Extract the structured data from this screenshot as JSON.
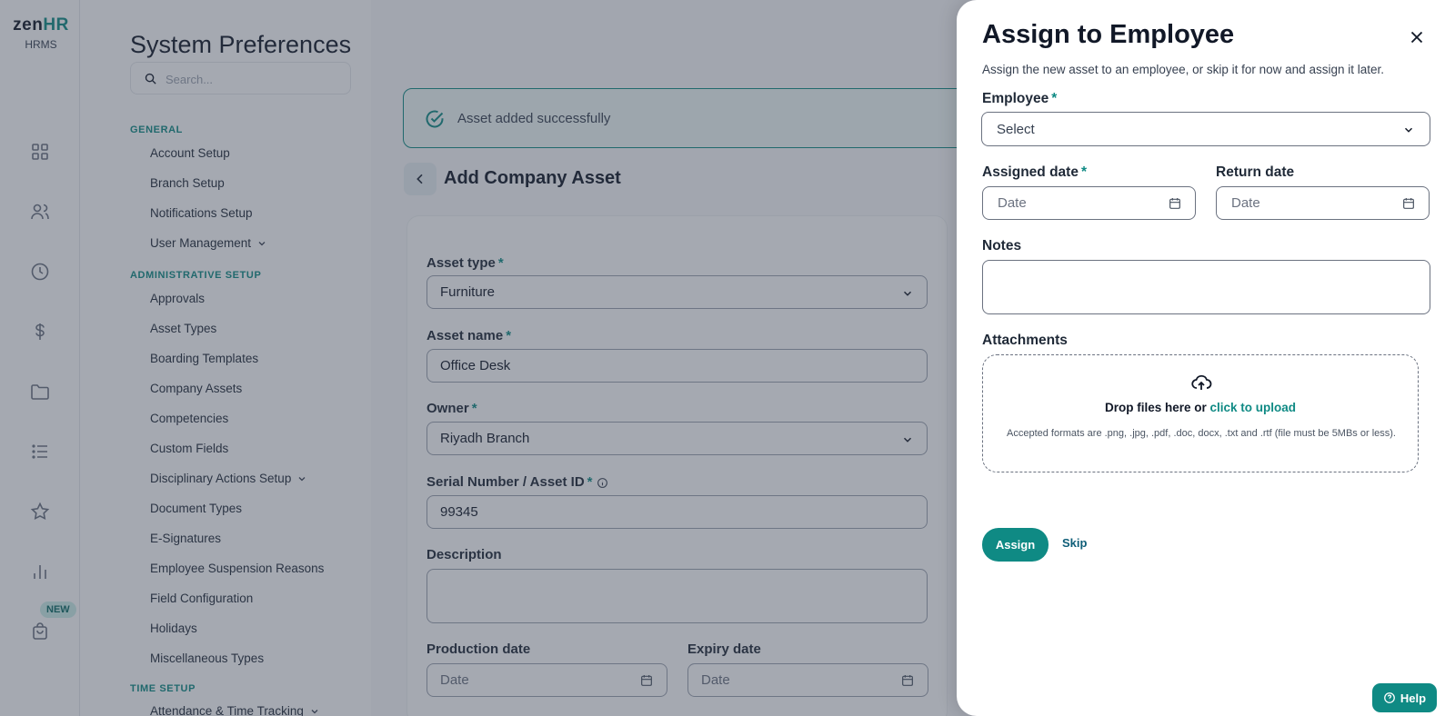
{
  "brand": {
    "logo_zen": "zen",
    "logo_hr": "HR",
    "subtitle": "HRMS"
  },
  "rail": {
    "icons": [
      "grid-icon",
      "users-icon",
      "clock-icon",
      "dollar-icon",
      "folder-icon",
      "list-icon",
      "star-icon",
      "bar-chart-icon",
      "shopping-bag-icon"
    ],
    "new_badge": "NEW"
  },
  "settings": {
    "title": "System Preferences",
    "search_placeholder": "Search...",
    "sections": [
      {
        "heading": "GENERAL",
        "items": [
          "Account Setup",
          "Branch Setup",
          "Notifications Setup",
          "User Management"
        ]
      },
      {
        "heading": "ADMINISTRATIVE SETUP",
        "items": [
          "Approvals",
          "Asset Types",
          "Boarding Templates",
          "Company Assets",
          "Competencies",
          "Custom Fields",
          "Disciplinary Actions Setup",
          "Document Types",
          "E-Signatures",
          "Employee Suspension Reasons",
          "Field Configuration",
          "Holidays",
          "Miscellaneous Types"
        ]
      },
      {
        "heading": "TIME SETUP",
        "items": [
          "Attendance & Time Tracking"
        ]
      }
    ]
  },
  "main": {
    "toast": "Asset added successfully",
    "page_title": "Add Company Asset",
    "form": {
      "asset_type_label": "Asset type",
      "asset_type_value": "Furniture",
      "asset_name_label": "Asset name",
      "asset_name_value": "Office Desk",
      "owner_label": "Owner",
      "owner_value": "Riyadh Branch",
      "serial_label": "Serial Number / Asset ID",
      "serial_value": "99345",
      "description_label": "Description",
      "production_label": "Production date",
      "production_placeholder": "Date",
      "expiry_label": "Expiry date",
      "expiry_placeholder": "Date",
      "required_mark": "*"
    }
  },
  "drawer": {
    "title": "Assign to Employee",
    "subtitle": "Assign the new asset to an employee, or skip it for now and assign it later.",
    "employee_label": "Employee",
    "employee_placeholder": "Select",
    "assigned_label": "Assigned date",
    "assigned_placeholder": "Date",
    "return_label": "Return date",
    "return_placeholder": "Date",
    "notes_label": "Notes",
    "attachments_label": "Attachments",
    "drop_text": "Drop files here or",
    "drop_link": "click to upload",
    "drop_note": "Accepted formats are .png, .jpg, .pdf, .doc, docx, .txt and .rtf (file must be 5MBs or less).",
    "assign_label": "Assign",
    "skip_label": "Skip",
    "required_mark": "*"
  },
  "help_label": "Help",
  "colors": {
    "accent": "#0f8a84",
    "overlay": "rgba(55,65,81,0.45)"
  }
}
